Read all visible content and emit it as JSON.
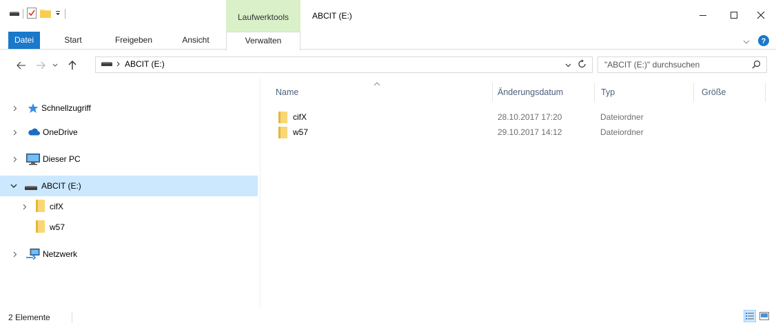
{
  "window": {
    "title": "ABCIT (E:)",
    "contextual_group": "Laufwerktools"
  },
  "ribbon": {
    "tabs": [
      {
        "label": "Datei"
      },
      {
        "label": "Start"
      },
      {
        "label": "Freigeben"
      },
      {
        "label": "Ansicht"
      },
      {
        "label": "Verwalten"
      }
    ]
  },
  "address": {
    "crumb": "ABCIT (E:)",
    "search_placeholder": "\"ABCIT (E:)\" durchsuchen"
  },
  "nav": {
    "items": [
      {
        "label": "Schnellzugriff",
        "icon": "star-icon"
      },
      {
        "label": "OneDrive",
        "icon": "cloud-icon"
      },
      {
        "label": "Dieser PC",
        "icon": "computer-icon"
      },
      {
        "label": "ABCIT (E:)",
        "icon": "drive-icon",
        "selected": true
      },
      {
        "label": "cifX",
        "icon": "folder-icon"
      },
      {
        "label": "w57",
        "icon": "folder-icon"
      },
      {
        "label": "Netzwerk",
        "icon": "network-icon"
      }
    ]
  },
  "list": {
    "columns": [
      "Name",
      "Änderungsdatum",
      "Typ",
      "Größe"
    ],
    "rows": [
      {
        "name": "cifX",
        "date": "28.10.2017 17:20",
        "type": "Dateiordner"
      },
      {
        "name": "w57",
        "date": "29.10.2017 14:12",
        "type": "Dateiordner"
      }
    ]
  },
  "status": {
    "count": "2 Elemente"
  },
  "colors": {
    "accent": "#1979ca",
    "selection": "#cce8ff",
    "context_tab": "#d9f0c8",
    "folder": "#f8d775"
  }
}
